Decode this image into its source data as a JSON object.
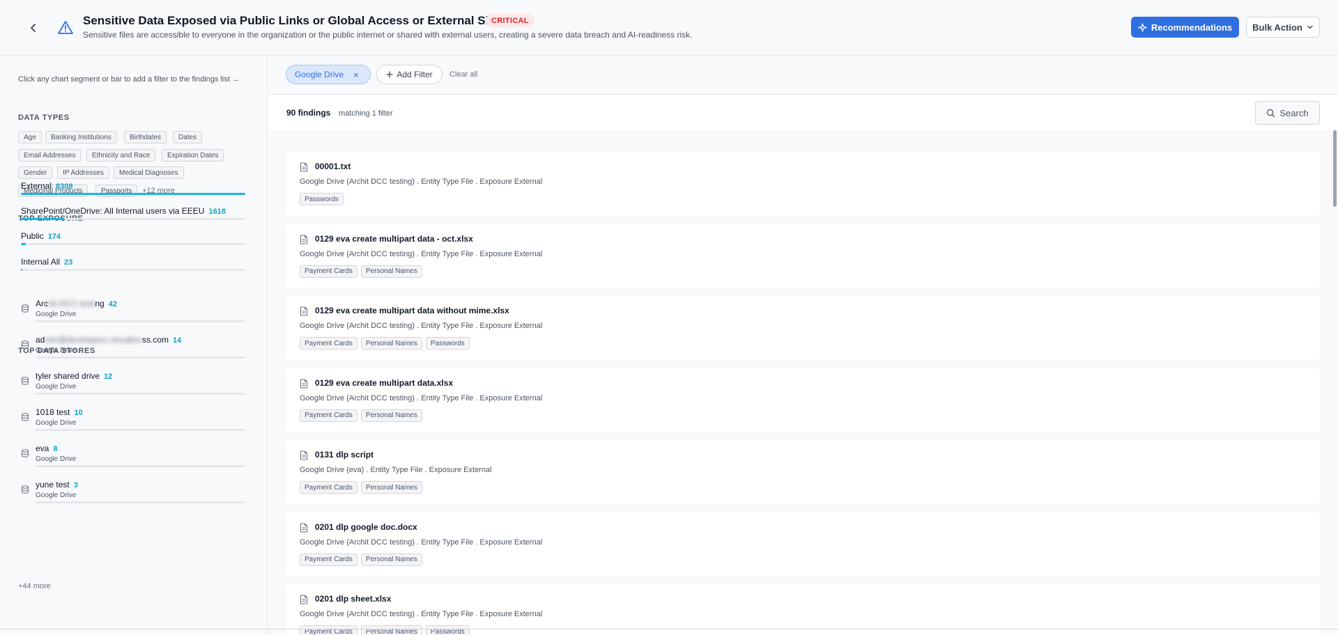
{
  "header": {
    "title": "Sensitive Data Exposed via Public Links or Global Access or External Sharing",
    "severity": "CRITICAL",
    "subtitle": "Sensitive files are accessible to everyone in the organization or the public internet or shared with external users, creating a severe data breach and AI-readiness risk.",
    "recommendations_label": "Recommendations",
    "bulk_action_label": "Bulk Action"
  },
  "sidebar": {
    "hint": "Click any chart segment or bar to add a filter to the findings list →",
    "data_types_title": "DATA TYPES",
    "data_types": [
      "Age",
      "Banking Institutions",
      "Birthdates",
      "Dates",
      "Email Addresses",
      "Ethnicity and Race",
      "Expiration Dates",
      "Gender",
      "IP Addresses",
      "Medical Diagnoses",
      "Medicinal Products",
      "Passports"
    ],
    "data_types_more": "+12 more",
    "exposure_title": "TOP EXPOSURE",
    "exposures": [
      {
        "label": "External",
        "count": "8308",
        "fraction": 1.0
      },
      {
        "label": "SharePoint/OneDrive: All Internal users via EEEU",
        "count": "1618",
        "fraction": 0.195
      },
      {
        "label": "Public",
        "count": "174",
        "fraction": 0.021
      },
      {
        "label": "Internal All",
        "count": "23",
        "fraction": 0.003
      }
    ],
    "stores_title": "TOP DATA STORES",
    "stores": [
      {
        "name_start": "Arc",
        "name_hidden": "hit DCC testi",
        "name_end": "ng",
        "count": "42",
        "source": "Google Drive"
      },
      {
        "name_start": "ad",
        "name_hidden": "min@developers.cloudbre",
        "name_end": "ss.com",
        "count": "14",
        "source": "Google Drive"
      },
      {
        "name_start": "tyler shared drive",
        "name_hidden": "",
        "name_end": "",
        "count": "12",
        "source": "Google Drive"
      },
      {
        "name_start": "1018 test",
        "name_hidden": "",
        "name_end": "",
        "count": "10",
        "source": "Google Drive"
      },
      {
        "name_start": "eva",
        "name_hidden": "",
        "name_end": "",
        "count": "8",
        "source": "Google Drive"
      },
      {
        "name_start": "yune test",
        "name_hidden": "",
        "name_end": "",
        "count": "3",
        "source": "Google Drive"
      }
    ],
    "stores_more": "+44 more"
  },
  "filters": {
    "active": "Google Drive",
    "remove_symbol": "×",
    "add_filter_label": "Add Filter",
    "clear_all_label": "Clear all"
  },
  "results": {
    "count_label": "90 findings",
    "matching_label": "matching 1 filter",
    "search_label": "Search"
  },
  "findings": [
    {
      "title": "00001.txt",
      "meta": "Google Drive (Archit DCC testing) . Entity Type File . Exposure External",
      "tags": [
        "Passwords"
      ]
    },
    {
      "title": "0129 eva create multipart data - oct.xlsx",
      "meta": "Google Drive (Archit DCC testing) . Entity Type File . Exposure External",
      "tags": [
        "Payment Cards",
        "Personal Names"
      ]
    },
    {
      "title": "0129 eva create multipart data without mime.xlsx",
      "meta": "Google Drive (Archit DCC testing) . Entity Type File . Exposure External",
      "tags": [
        "Payment Cards",
        "Personal Names",
        "Passwords"
      ]
    },
    {
      "title": "0129 eva create multipart data.xlsx",
      "meta": "Google Drive (Archit DCC testing) . Entity Type File . Exposure External",
      "tags": [
        "Payment Cards",
        "Personal Names"
      ]
    },
    {
      "title": "0131 dlp script",
      "meta": "Google Drive (eva) . Entity Type File . Exposure External",
      "tags": [
        "Payment Cards",
        "Personal Names"
      ]
    },
    {
      "title": "0201 dlp google doc.docx",
      "meta": "Google Drive (Archit DCC testing) . Entity Type File . Exposure External",
      "tags": [
        "Payment Cards",
        "Personal Names"
      ]
    },
    {
      "title": "0201 dlp sheet.xlsx",
      "meta": "Google Drive (Archit DCC testing) . Entity Type File . Exposure External",
      "tags": [
        "Payment Cards",
        "Personal Names",
        "Passwords"
      ]
    }
  ]
}
